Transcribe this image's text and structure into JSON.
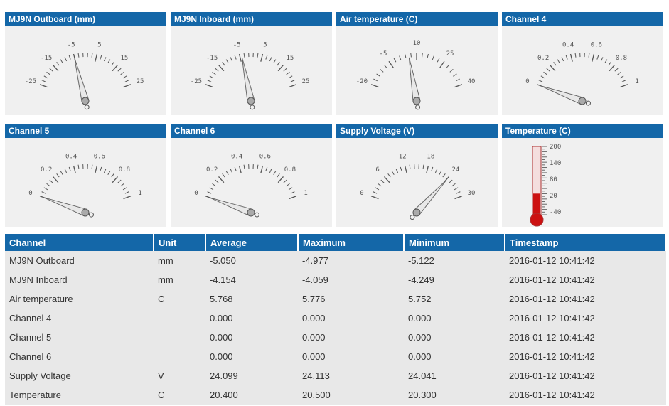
{
  "gauges": [
    {
      "title": "MJ9N Outboard (mm)",
      "min": -25,
      "max": 25,
      "ticks": [
        "-25",
        "-15",
        "-5",
        "5",
        "15",
        "25"
      ],
      "value": -5.05
    },
    {
      "title": "MJ9N Inboard (mm)",
      "min": -25,
      "max": 25,
      "ticks": [
        "-25",
        "-15",
        "-5",
        "5",
        "15",
        "25"
      ],
      "value": -4.154
    },
    {
      "title": "Air temperature (C)",
      "min": -20,
      "max": 40,
      "ticks": [
        "-20",
        "-5",
        "10",
        "25",
        "40"
      ],
      "value": 5.768
    },
    {
      "title": "Channel 4",
      "min": 0,
      "max": 1,
      "ticks": [
        "0",
        "0.2",
        "0.4",
        "0.6",
        "0.8",
        "1"
      ],
      "value": 0
    },
    {
      "title": "Channel 5",
      "min": 0,
      "max": 1,
      "ticks": [
        "0",
        "0.2",
        "0.4",
        "0.6",
        "0.8",
        "1"
      ],
      "value": 0
    },
    {
      "title": "Channel 6",
      "min": 0,
      "max": 1,
      "ticks": [
        "0",
        "0.2",
        "0.4",
        "0.6",
        "0.8",
        "1"
      ],
      "value": 0
    },
    {
      "title": "Supply Voltage (V)",
      "min": 0,
      "max": 30,
      "ticks": [
        "0",
        "6",
        "12",
        "18",
        "24",
        "30"
      ],
      "value": 24.099
    }
  ],
  "thermometer": {
    "title": "Temperature (C)",
    "min": -60,
    "max": 200,
    "ticks": [
      "200",
      "140",
      "80",
      "20",
      "-40"
    ],
    "value": 20.4,
    "color": "#cc1111"
  },
  "table": {
    "headers": [
      "Channel",
      "Unit",
      "Average",
      "Maximum",
      "Minimum",
      "Timestamp"
    ],
    "rows": [
      [
        "MJ9N Outboard",
        "mm",
        "-5.050",
        "-4.977",
        "-5.122",
        "2016-01-12 10:41:42"
      ],
      [
        "MJ9N Inboard",
        "mm",
        "-4.154",
        "-4.059",
        "-4.249",
        "2016-01-12 10:41:42"
      ],
      [
        "Air temperature",
        "C",
        "5.768",
        "5.776",
        "5.752",
        "2016-01-12 10:41:42"
      ],
      [
        "Channel 4",
        "",
        "0.000",
        "0.000",
        "0.000",
        "2016-01-12 10:41:42"
      ],
      [
        "Channel 5",
        "",
        "0.000",
        "0.000",
        "0.000",
        "2016-01-12 10:41:42"
      ],
      [
        "Channel 6",
        "",
        "0.000",
        "0.000",
        "0.000",
        "2016-01-12 10:41:42"
      ],
      [
        "Supply Voltage",
        "V",
        "24.099",
        "24.113",
        "24.041",
        "2016-01-12 10:41:42"
      ],
      [
        "Temperature",
        "C",
        "20.400",
        "20.500",
        "20.300",
        "2016-01-12 10:41:42"
      ]
    ]
  },
  "colors": {
    "header": "#1467a8",
    "panel": "#f0f0f0",
    "row": "#e8e8e8"
  }
}
